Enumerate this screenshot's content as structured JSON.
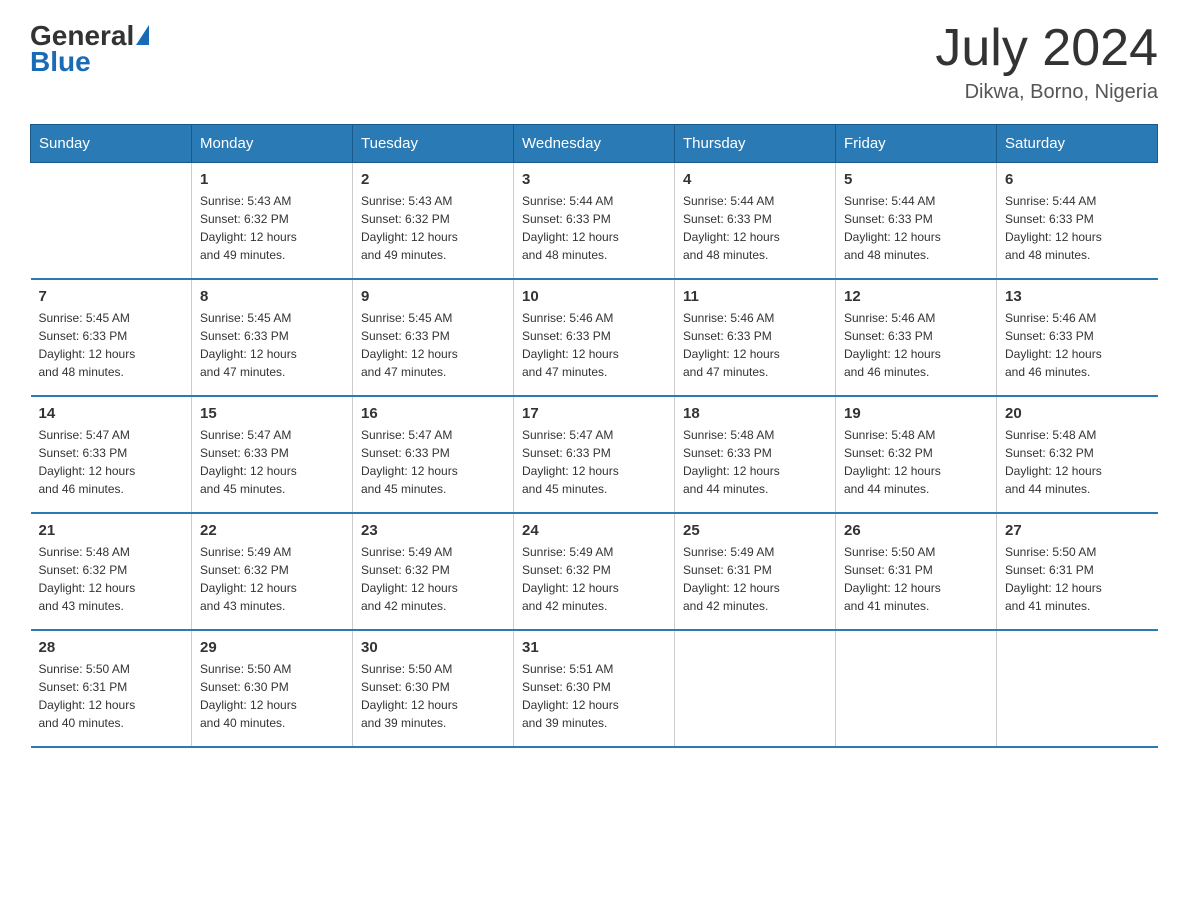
{
  "header": {
    "logo_general": "General",
    "logo_blue": "Blue",
    "month_year": "July 2024",
    "location": "Dikwa, Borno, Nigeria"
  },
  "weekdays": [
    "Sunday",
    "Monday",
    "Tuesday",
    "Wednesday",
    "Thursday",
    "Friday",
    "Saturday"
  ],
  "weeks": [
    [
      {
        "day": "",
        "info": ""
      },
      {
        "day": "1",
        "info": "Sunrise: 5:43 AM\nSunset: 6:32 PM\nDaylight: 12 hours\nand 49 minutes."
      },
      {
        "day": "2",
        "info": "Sunrise: 5:43 AM\nSunset: 6:32 PM\nDaylight: 12 hours\nand 49 minutes."
      },
      {
        "day": "3",
        "info": "Sunrise: 5:44 AM\nSunset: 6:33 PM\nDaylight: 12 hours\nand 48 minutes."
      },
      {
        "day": "4",
        "info": "Sunrise: 5:44 AM\nSunset: 6:33 PM\nDaylight: 12 hours\nand 48 minutes."
      },
      {
        "day": "5",
        "info": "Sunrise: 5:44 AM\nSunset: 6:33 PM\nDaylight: 12 hours\nand 48 minutes."
      },
      {
        "day": "6",
        "info": "Sunrise: 5:44 AM\nSunset: 6:33 PM\nDaylight: 12 hours\nand 48 minutes."
      }
    ],
    [
      {
        "day": "7",
        "info": "Sunrise: 5:45 AM\nSunset: 6:33 PM\nDaylight: 12 hours\nand 48 minutes."
      },
      {
        "day": "8",
        "info": "Sunrise: 5:45 AM\nSunset: 6:33 PM\nDaylight: 12 hours\nand 47 minutes."
      },
      {
        "day": "9",
        "info": "Sunrise: 5:45 AM\nSunset: 6:33 PM\nDaylight: 12 hours\nand 47 minutes."
      },
      {
        "day": "10",
        "info": "Sunrise: 5:46 AM\nSunset: 6:33 PM\nDaylight: 12 hours\nand 47 minutes."
      },
      {
        "day": "11",
        "info": "Sunrise: 5:46 AM\nSunset: 6:33 PM\nDaylight: 12 hours\nand 47 minutes."
      },
      {
        "day": "12",
        "info": "Sunrise: 5:46 AM\nSunset: 6:33 PM\nDaylight: 12 hours\nand 46 minutes."
      },
      {
        "day": "13",
        "info": "Sunrise: 5:46 AM\nSunset: 6:33 PM\nDaylight: 12 hours\nand 46 minutes."
      }
    ],
    [
      {
        "day": "14",
        "info": "Sunrise: 5:47 AM\nSunset: 6:33 PM\nDaylight: 12 hours\nand 46 minutes."
      },
      {
        "day": "15",
        "info": "Sunrise: 5:47 AM\nSunset: 6:33 PM\nDaylight: 12 hours\nand 45 minutes."
      },
      {
        "day": "16",
        "info": "Sunrise: 5:47 AM\nSunset: 6:33 PM\nDaylight: 12 hours\nand 45 minutes."
      },
      {
        "day": "17",
        "info": "Sunrise: 5:47 AM\nSunset: 6:33 PM\nDaylight: 12 hours\nand 45 minutes."
      },
      {
        "day": "18",
        "info": "Sunrise: 5:48 AM\nSunset: 6:33 PM\nDaylight: 12 hours\nand 44 minutes."
      },
      {
        "day": "19",
        "info": "Sunrise: 5:48 AM\nSunset: 6:32 PM\nDaylight: 12 hours\nand 44 minutes."
      },
      {
        "day": "20",
        "info": "Sunrise: 5:48 AM\nSunset: 6:32 PM\nDaylight: 12 hours\nand 44 minutes."
      }
    ],
    [
      {
        "day": "21",
        "info": "Sunrise: 5:48 AM\nSunset: 6:32 PM\nDaylight: 12 hours\nand 43 minutes."
      },
      {
        "day": "22",
        "info": "Sunrise: 5:49 AM\nSunset: 6:32 PM\nDaylight: 12 hours\nand 43 minutes."
      },
      {
        "day": "23",
        "info": "Sunrise: 5:49 AM\nSunset: 6:32 PM\nDaylight: 12 hours\nand 42 minutes."
      },
      {
        "day": "24",
        "info": "Sunrise: 5:49 AM\nSunset: 6:32 PM\nDaylight: 12 hours\nand 42 minutes."
      },
      {
        "day": "25",
        "info": "Sunrise: 5:49 AM\nSunset: 6:31 PM\nDaylight: 12 hours\nand 42 minutes."
      },
      {
        "day": "26",
        "info": "Sunrise: 5:50 AM\nSunset: 6:31 PM\nDaylight: 12 hours\nand 41 minutes."
      },
      {
        "day": "27",
        "info": "Sunrise: 5:50 AM\nSunset: 6:31 PM\nDaylight: 12 hours\nand 41 minutes."
      }
    ],
    [
      {
        "day": "28",
        "info": "Sunrise: 5:50 AM\nSunset: 6:31 PM\nDaylight: 12 hours\nand 40 minutes."
      },
      {
        "day": "29",
        "info": "Sunrise: 5:50 AM\nSunset: 6:30 PM\nDaylight: 12 hours\nand 40 minutes."
      },
      {
        "day": "30",
        "info": "Sunrise: 5:50 AM\nSunset: 6:30 PM\nDaylight: 12 hours\nand 39 minutes."
      },
      {
        "day": "31",
        "info": "Sunrise: 5:51 AM\nSunset: 6:30 PM\nDaylight: 12 hours\nand 39 minutes."
      },
      {
        "day": "",
        "info": ""
      },
      {
        "day": "",
        "info": ""
      },
      {
        "day": "",
        "info": ""
      }
    ]
  ]
}
